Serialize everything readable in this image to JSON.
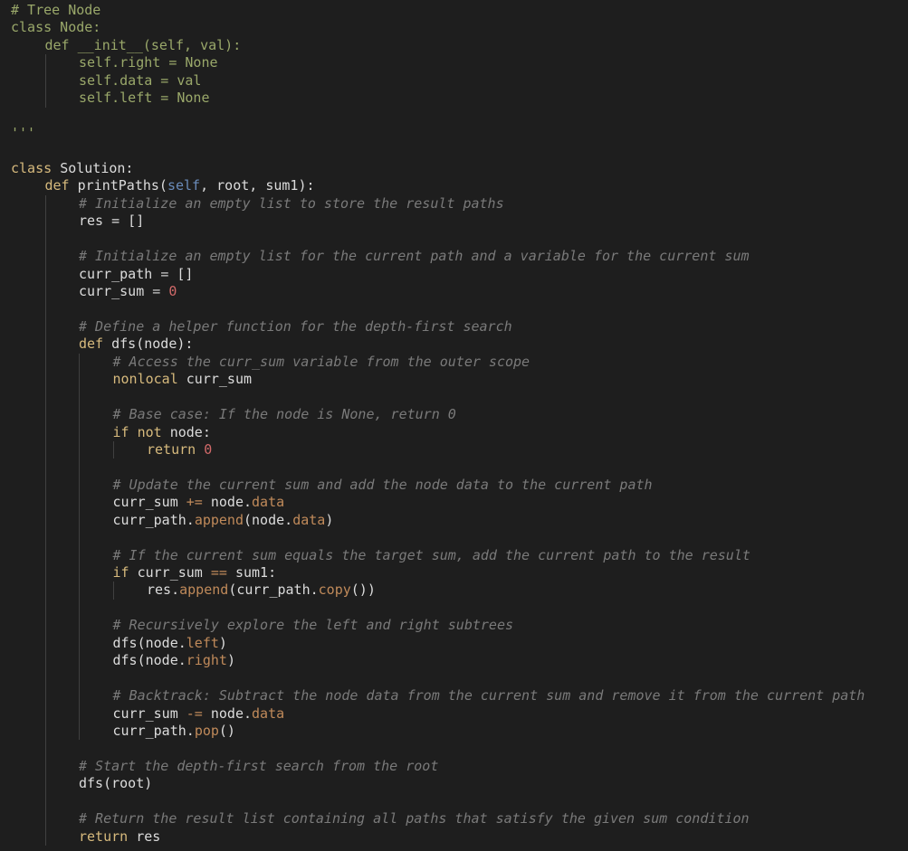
{
  "editor": {
    "language": "python",
    "theme": {
      "background": "#1e1e1e",
      "keyword": "#d7ba7d",
      "text": "#dcdcdc",
      "comment": "#7a7a7a",
      "top_comment_block": "#9aa86a",
      "self_param": "#6a8cbb",
      "number": "#d16969",
      "attribute": "#c08a5a"
    },
    "lines": [
      {
        "indent": 0,
        "tokens": [
          {
            "t": "# Tree Node",
            "c": "top"
          }
        ]
      },
      {
        "indent": 0,
        "tokens": [
          {
            "t": "class Node:",
            "c": "top"
          }
        ]
      },
      {
        "indent": 1,
        "tokens": [
          {
            "t": "def __init__(self, val):",
            "c": "top"
          }
        ]
      },
      {
        "indent": 2,
        "tokens": [
          {
            "t": "self.right = None",
            "c": "top"
          }
        ]
      },
      {
        "indent": 2,
        "tokens": [
          {
            "t": "self.data = val",
            "c": "top"
          }
        ]
      },
      {
        "indent": 2,
        "tokens": [
          {
            "t": "self.left = None",
            "c": "top"
          }
        ]
      },
      {
        "indent": 0,
        "tokens": []
      },
      {
        "indent": 0,
        "tokens": [
          {
            "t": "'''",
            "c": "top"
          }
        ]
      },
      {
        "indent": 0,
        "tokens": []
      },
      {
        "indent": 0,
        "tokens": [
          {
            "t": "class ",
            "c": "kw"
          },
          {
            "t": "Solution:",
            "c": "txt"
          }
        ]
      },
      {
        "indent": 1,
        "tokens": [
          {
            "t": "def ",
            "c": "kw"
          },
          {
            "t": "printPaths(",
            "c": "txt"
          },
          {
            "t": "self",
            "c": "self"
          },
          {
            "t": ", root, sum1):",
            "c": "txt"
          }
        ]
      },
      {
        "indent": 2,
        "tokens": [
          {
            "t": "# Initialize an empty list to store the result paths",
            "c": "cm"
          }
        ]
      },
      {
        "indent": 2,
        "tokens": [
          {
            "t": "res = []",
            "c": "txt"
          }
        ]
      },
      {
        "indent": 2,
        "tokens": []
      },
      {
        "indent": 2,
        "tokens": [
          {
            "t": "# Initialize an empty list for the current path and a variable for the current sum",
            "c": "cm"
          }
        ]
      },
      {
        "indent": 2,
        "tokens": [
          {
            "t": "curr_path ",
            "c": "txt"
          },
          {
            "t": "=",
            "c": "op"
          },
          {
            "t": " []",
            "c": "txt"
          }
        ]
      },
      {
        "indent": 2,
        "tokens": [
          {
            "t": "curr_sum ",
            "c": "txt"
          },
          {
            "t": "=",
            "c": "op"
          },
          {
            "t": " ",
            "c": "txt"
          },
          {
            "t": "0",
            "c": "num"
          }
        ]
      },
      {
        "indent": 2,
        "tokens": []
      },
      {
        "indent": 2,
        "tokens": [
          {
            "t": "# Define a helper function for the depth-first search",
            "c": "cm"
          }
        ]
      },
      {
        "indent": 2,
        "tokens": [
          {
            "t": "def ",
            "c": "kw"
          },
          {
            "t": "dfs(node):",
            "c": "txt"
          }
        ]
      },
      {
        "indent": 3,
        "tokens": [
          {
            "t": "# Access the curr_sum variable from the outer scope",
            "c": "cm"
          }
        ]
      },
      {
        "indent": 3,
        "tokens": [
          {
            "t": "nonlocal ",
            "c": "kw"
          },
          {
            "t": "curr_sum",
            "c": "txt"
          }
        ]
      },
      {
        "indent": 3,
        "tokens": []
      },
      {
        "indent": 3,
        "tokens": [
          {
            "t": "# Base case: If the node is None, return 0",
            "c": "cm"
          }
        ]
      },
      {
        "indent": 3,
        "tokens": [
          {
            "t": "if ",
            "c": "kw"
          },
          {
            "t": "not ",
            "c": "kw"
          },
          {
            "t": "node:",
            "c": "txt"
          }
        ]
      },
      {
        "indent": 4,
        "tokens": [
          {
            "t": "return ",
            "c": "kw"
          },
          {
            "t": "0",
            "c": "num"
          }
        ]
      },
      {
        "indent": 3,
        "tokens": []
      },
      {
        "indent": 3,
        "tokens": [
          {
            "t": "# Update the current sum and add the node data to the current path",
            "c": "cm"
          }
        ]
      },
      {
        "indent": 3,
        "tokens": [
          {
            "t": "curr_sum ",
            "c": "txt"
          },
          {
            "t": "+=",
            "c": "attr"
          },
          {
            "t": " node.",
            "c": "txt"
          },
          {
            "t": "data",
            "c": "attr"
          }
        ]
      },
      {
        "indent": 3,
        "tokens": [
          {
            "t": "curr_path.",
            "c": "txt"
          },
          {
            "t": "append",
            "c": "attr"
          },
          {
            "t": "(node.",
            "c": "txt"
          },
          {
            "t": "data",
            "c": "attr"
          },
          {
            "t": ")",
            "c": "txt"
          }
        ]
      },
      {
        "indent": 3,
        "tokens": []
      },
      {
        "indent": 3,
        "tokens": [
          {
            "t": "# If the current sum equals the target sum, add the current path to the result",
            "c": "cm"
          }
        ]
      },
      {
        "indent": 3,
        "tokens": [
          {
            "t": "if ",
            "c": "kw"
          },
          {
            "t": "curr_sum ",
            "c": "txt"
          },
          {
            "t": "==",
            "c": "attr"
          },
          {
            "t": " sum1:",
            "c": "txt"
          }
        ]
      },
      {
        "indent": 4,
        "tokens": [
          {
            "t": "res.",
            "c": "txt"
          },
          {
            "t": "append",
            "c": "attr"
          },
          {
            "t": "(curr_path.",
            "c": "txt"
          },
          {
            "t": "copy",
            "c": "attr"
          },
          {
            "t": "())",
            "c": "txt"
          }
        ]
      },
      {
        "indent": 3,
        "tokens": []
      },
      {
        "indent": 3,
        "tokens": [
          {
            "t": "# Recursively explore the left and right subtrees",
            "c": "cm"
          }
        ]
      },
      {
        "indent": 3,
        "tokens": [
          {
            "t": "dfs(node.",
            "c": "txt"
          },
          {
            "t": "left",
            "c": "attr"
          },
          {
            "t": ")",
            "c": "txt"
          }
        ]
      },
      {
        "indent": 3,
        "tokens": [
          {
            "t": "dfs(node.",
            "c": "txt"
          },
          {
            "t": "right",
            "c": "attr"
          },
          {
            "t": ")",
            "c": "txt"
          }
        ]
      },
      {
        "indent": 3,
        "tokens": []
      },
      {
        "indent": 3,
        "tokens": [
          {
            "t": "# Backtrack: Subtract the node data from the current sum and remove it from the current path",
            "c": "cm"
          }
        ]
      },
      {
        "indent": 3,
        "tokens": [
          {
            "t": "curr_sum ",
            "c": "txt"
          },
          {
            "t": "-=",
            "c": "attr"
          },
          {
            "t": " node.",
            "c": "txt"
          },
          {
            "t": "data",
            "c": "attr"
          }
        ]
      },
      {
        "indent": 3,
        "tokens": [
          {
            "t": "curr_path.",
            "c": "txt"
          },
          {
            "t": "pop",
            "c": "attr"
          },
          {
            "t": "()",
            "c": "txt"
          }
        ]
      },
      {
        "indent": 2,
        "tokens": []
      },
      {
        "indent": 2,
        "tokens": [
          {
            "t": "# Start the depth-first search from the root",
            "c": "cm"
          }
        ]
      },
      {
        "indent": 2,
        "tokens": [
          {
            "t": "dfs(root)",
            "c": "txt"
          }
        ]
      },
      {
        "indent": 2,
        "tokens": []
      },
      {
        "indent": 2,
        "tokens": [
          {
            "t": "# Return the result list containing all paths that satisfy the given sum condition",
            "c": "cm"
          }
        ]
      },
      {
        "indent": 2,
        "tokens": [
          {
            "t": "return ",
            "c": "kw"
          },
          {
            "t": "res",
            "c": "txt"
          }
        ]
      }
    ]
  }
}
